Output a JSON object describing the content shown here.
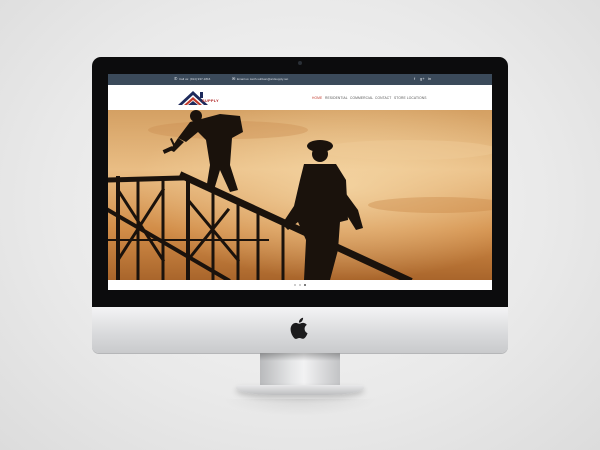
{
  "topbar": {
    "call_text": "Call us: (914) 937-1816",
    "email_text": "Email us: keith.sullivan@ardsupply.net",
    "social_icons": [
      "facebook-icon",
      "google-plus-icon",
      "linkedin-icon"
    ]
  },
  "logo": {
    "word": "SUPPLY",
    "colors": {
      "navy": "#1d2a5c",
      "red": "#c0392b"
    }
  },
  "nav": {
    "items": [
      {
        "label": "HOME",
        "active": true
      },
      {
        "label": "RESIDENTIAL",
        "active": false
      },
      {
        "label": "COMMERCIAL",
        "active": false
      },
      {
        "label": "CONTACT",
        "active": false
      },
      {
        "label": "STORE LOCATIONS",
        "active": false
      }
    ]
  },
  "hero": {
    "image": "silhouette-of-construction-workers-on-roof-truss-at-sunset",
    "colors": {
      "sky_light": "#f3c88c",
      "sky_mid": "#d9954a",
      "sky_dark": "#9a5a24",
      "silhouette": "#1a120c"
    }
  },
  "slider": {
    "dot_count": 3,
    "active_index": 2
  },
  "colors": {
    "topbar": "#3b4a5a",
    "nav_active": "#c0392b",
    "nav_text": "#555555",
    "bezel": "#0c0c0d"
  }
}
